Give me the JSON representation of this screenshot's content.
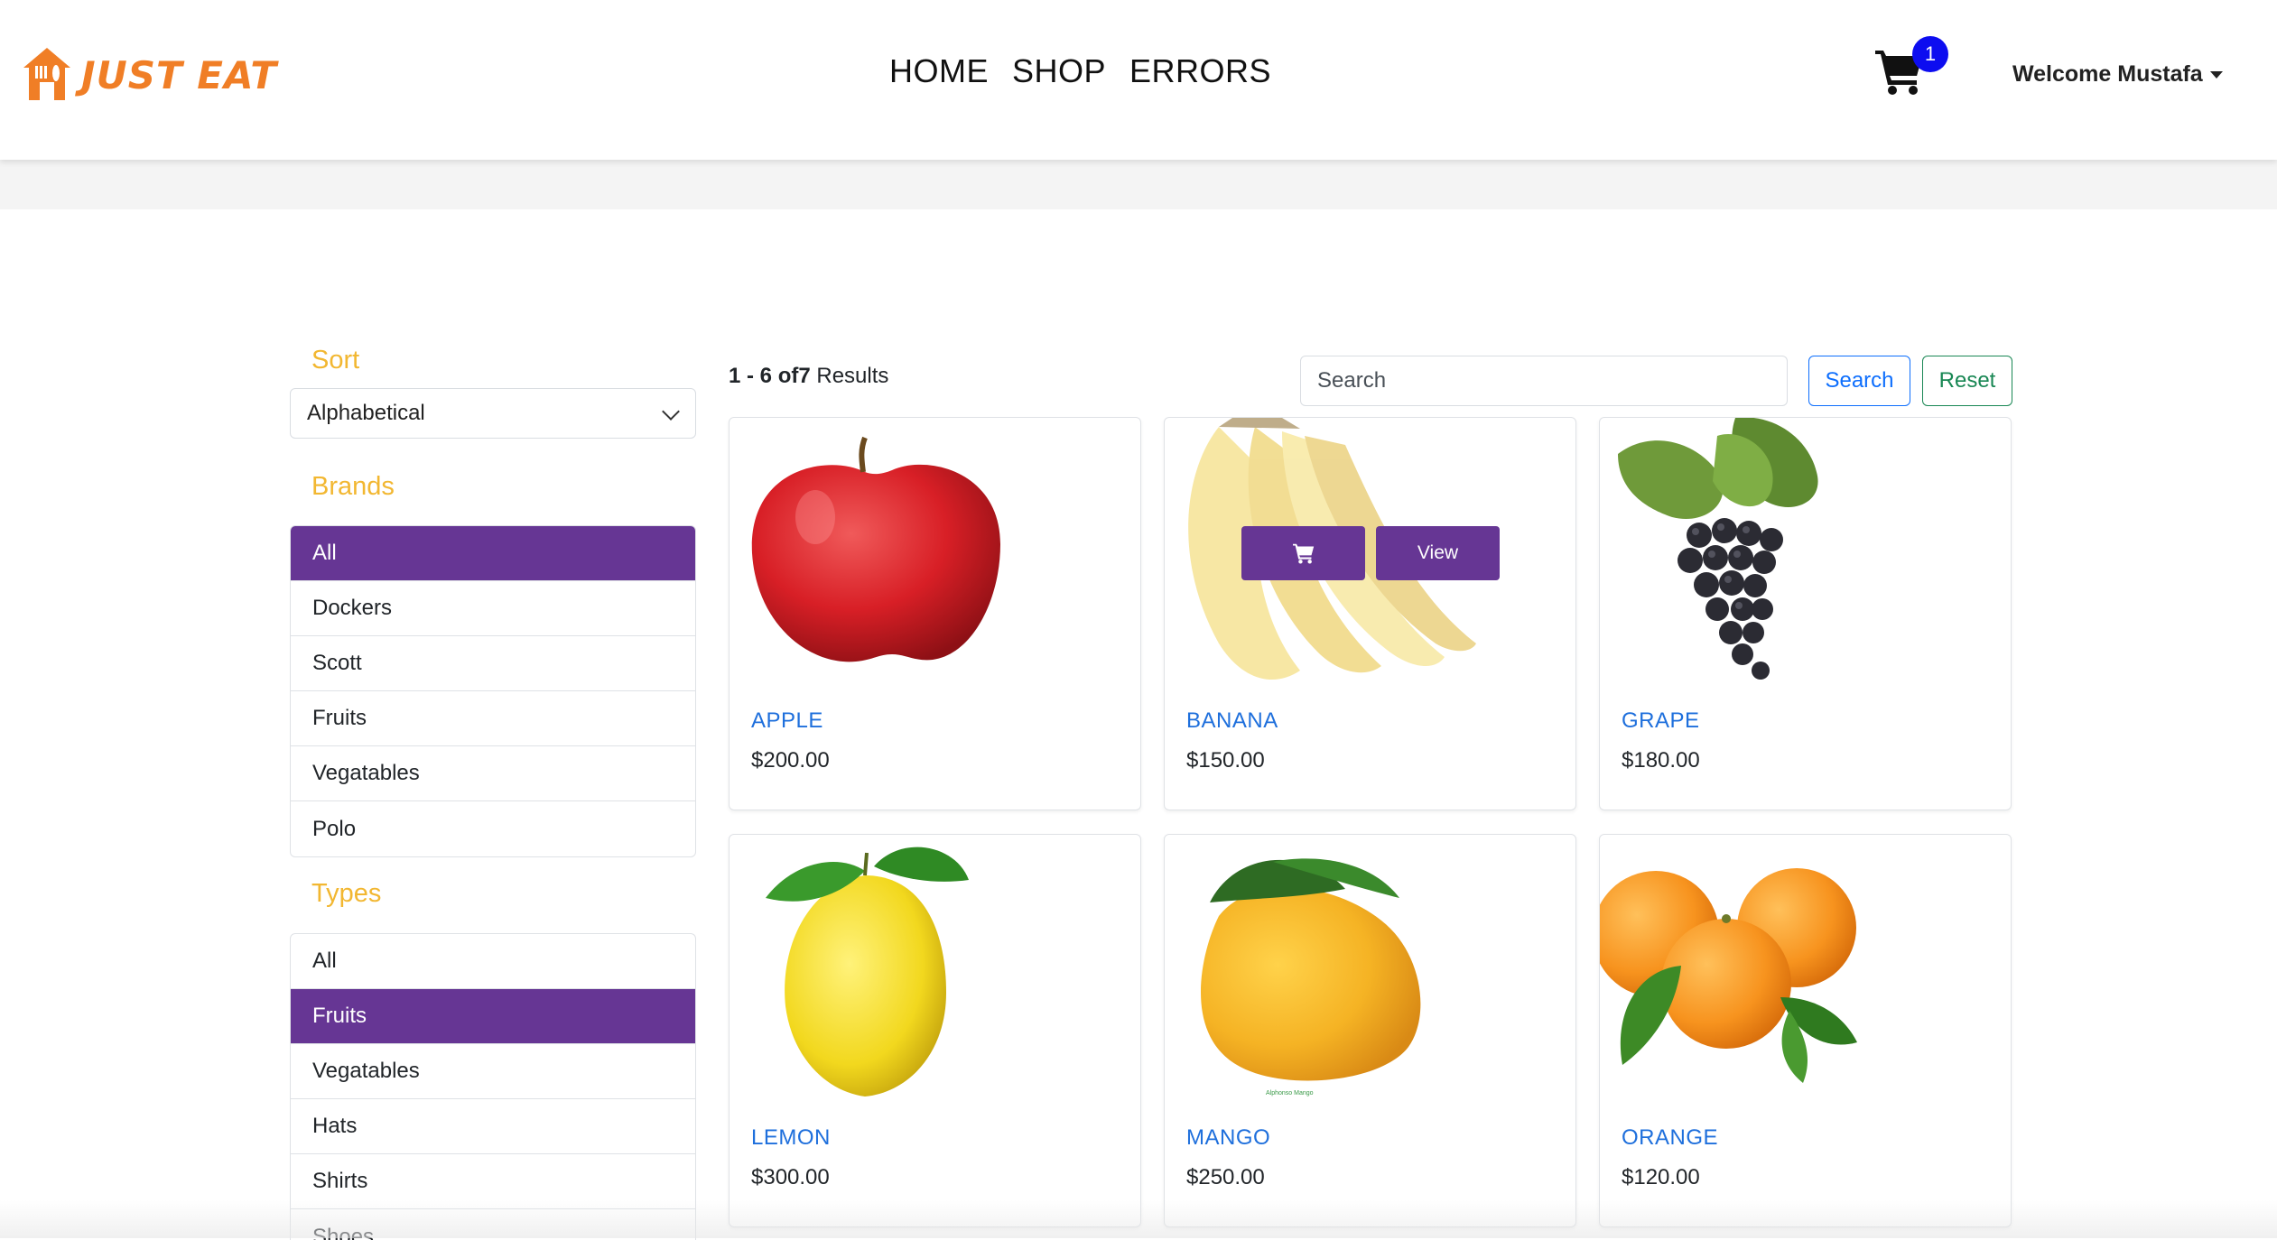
{
  "brand": {
    "name": "JUST EAT",
    "accent": "#f07e26"
  },
  "nav": {
    "links": [
      "HOME",
      "SHOP",
      "ERRORS"
    ]
  },
  "cart": {
    "count": "1",
    "badge_color": "#0d0df0"
  },
  "user": {
    "welcome": "Welcome Mustafa"
  },
  "sidebar": {
    "sort_heading": "Sort",
    "sort_value": "Alphabetical",
    "brands_heading": "Brands",
    "brands": [
      "All",
      "Dockers",
      "Scott",
      "Fruits",
      "Vegatables",
      "Polo"
    ],
    "brands_active": "All",
    "types_heading": "Types",
    "types": [
      "All",
      "Fruits",
      "Vegatables",
      "Hats",
      "Shirts",
      "Shoes"
    ],
    "types_active": "Fruits",
    "active_color": "#663694",
    "heading_color": "#f2b731"
  },
  "results": {
    "range": "1 - 6 of",
    "total": "7",
    "suffix": " Results"
  },
  "search": {
    "placeholder": "Search",
    "search_label": "Search",
    "reset_label": "Reset"
  },
  "products": [
    {
      "name": "APPLE",
      "price": "$200.00"
    },
    {
      "name": "BANANA",
      "price": "$150.00",
      "hover": true,
      "view_label": "View"
    },
    {
      "name": "GRAPE",
      "price": "$180.00"
    },
    {
      "name": "LEMON",
      "price": "$300.00"
    },
    {
      "name": "MANGO",
      "price": "$250.00",
      "image_caption": "Alphonso Mango"
    },
    {
      "name": "ORANGE",
      "price": "$120.00"
    }
  ]
}
